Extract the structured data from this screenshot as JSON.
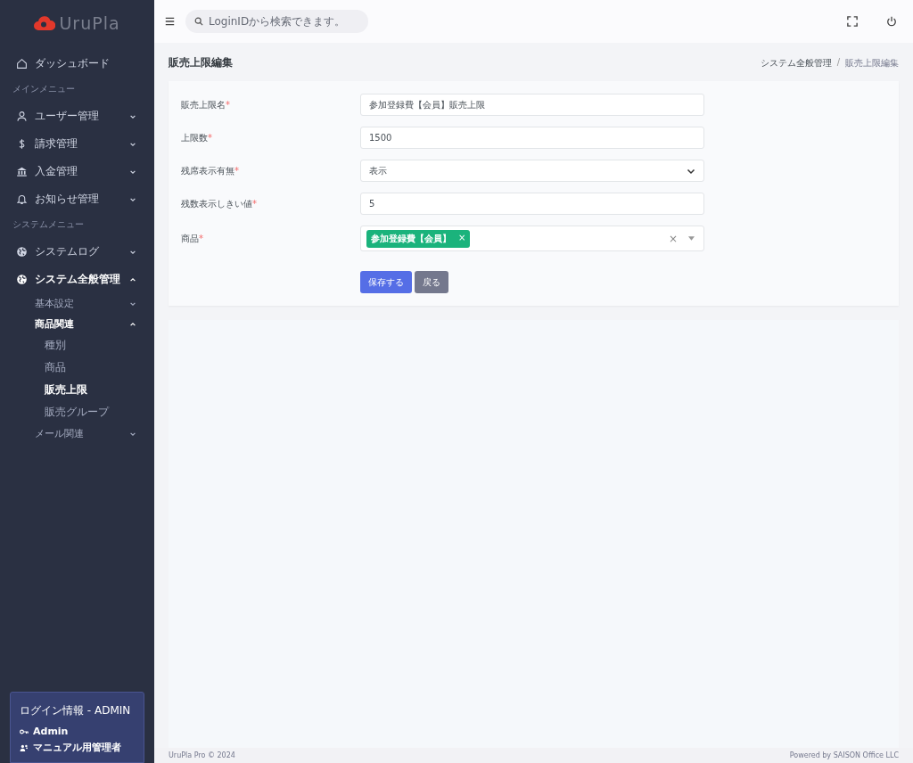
{
  "sidebar": {
    "logo": "UruPla",
    "items": [
      {
        "kind": "link",
        "label": "ダッシュボード",
        "selected": false
      },
      {
        "kind": "heading",
        "label": "メインメニュー"
      },
      {
        "kind": "menu",
        "label": "ユーザー管理",
        "expanded": false,
        "selected": false
      },
      {
        "kind": "menu",
        "label": "請求管理",
        "expanded": false,
        "selected": false
      },
      {
        "kind": "menu",
        "label": "入金管理",
        "expanded": false,
        "selected": false
      },
      {
        "kind": "menu",
        "label": "お知らせ管理",
        "expanded": false,
        "selected": false
      },
      {
        "kind": "heading",
        "label": "システムメニュー"
      },
      {
        "kind": "menu",
        "label": "システムログ",
        "expanded": false,
        "selected": false
      },
      {
        "kind": "menu",
        "label": "システム全般管理",
        "expanded": true,
        "selected": true,
        "children": [
          {
            "label": "基本設定",
            "expanded": false,
            "selected": false
          },
          {
            "label": "商品関連",
            "expanded": true,
            "selected": true,
            "children": [
              {
                "label": "種別",
                "selected": false
              },
              {
                "label": "商品",
                "selected": false
              },
              {
                "label": "販売上限",
                "selected": true
              },
              {
                "label": "販売グループ",
                "selected": false
              }
            ]
          },
          {
            "label": "メール関連",
            "expanded": false,
            "selected": false
          }
        ]
      }
    ],
    "login_info": {
      "title": "ログイン情報 - ADMIN",
      "user": "Admin",
      "role": "マニュアル用管理者"
    }
  },
  "topbar": {
    "search": {
      "placeholder": "LoginIDから検索できます。"
    }
  },
  "page": {
    "title": "販売上限編集",
    "breadcrumb": [
      "システム全般管理",
      "販売上限編集"
    ],
    "breadcrumb_separator": "/"
  },
  "form": {
    "fields": [
      {
        "kind": "text",
        "label": "販売上限名",
        "required_mark": "*",
        "value": "参加登録費【会員】販売上限"
      },
      {
        "kind": "text",
        "label": "上限数",
        "required_mark": "*",
        "value": "1500"
      },
      {
        "kind": "select",
        "label": "残席表示有無",
        "required_mark": "*",
        "value": "表示"
      },
      {
        "kind": "text",
        "label": "残数表示しきい値",
        "required_mark": "*",
        "value": "5"
      },
      {
        "kind": "tags",
        "label": "商品",
        "required_mark": "*",
        "tags": [
          {
            "label": "参加登録費【会員】",
            "remove": "×"
          }
        ],
        "clear": "×"
      }
    ],
    "buttons": [
      {
        "kind": "primary",
        "label": "保存する"
      },
      {
        "kind": "secondary",
        "label": "戻る"
      }
    ]
  },
  "footer": {
    "left": "UruPla Pro © 2024",
    "right": "Powered by SAISON Office LLC"
  }
}
